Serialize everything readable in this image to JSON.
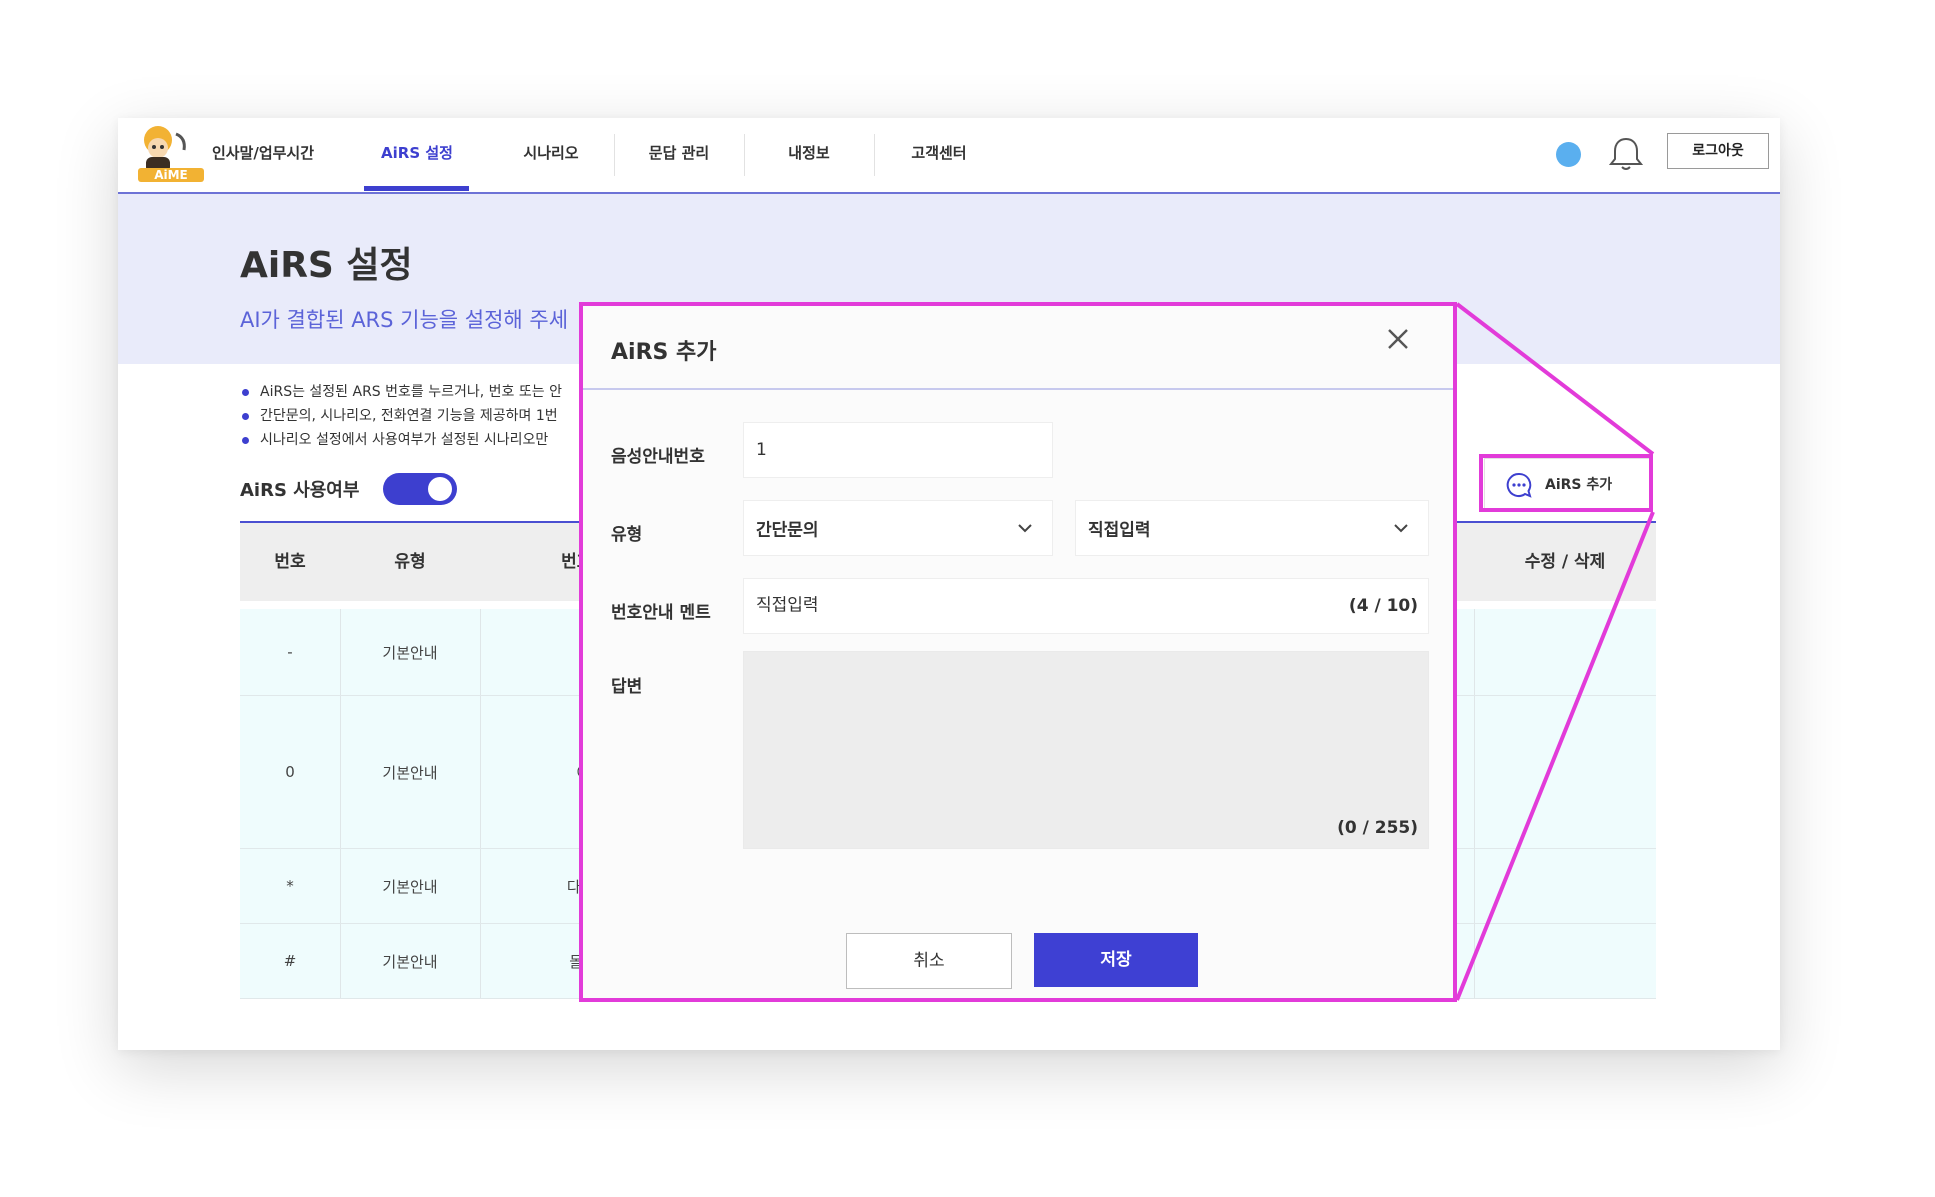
{
  "nav": {
    "items": [
      {
        "label": "인사말/업무시간"
      },
      {
        "label": "AiRS 설정"
      },
      {
        "label": "시나리오"
      },
      {
        "label": "문답 관리"
      },
      {
        "label": "내정보"
      },
      {
        "label": "고객센터"
      }
    ],
    "active_index": 1,
    "logout_label": "로그아웃",
    "logo_text": "AiME"
  },
  "hero": {
    "title": "AiRS 설정",
    "subtitle": "AI가 결합된 ARS 기능을 설정해 주세"
  },
  "notes": [
    "AiRS는 설정된 ARS 번호를 누르거나, 번호 또는 안",
    "간단문의, 시나리오, 전화연결 기능을 제공하며 1번",
    "시나리오 설정에서 사용여부가 설정된 시나리오만"
  ],
  "toggle": {
    "label": "AiRS 사용여부",
    "on": true
  },
  "add_button": {
    "label": "AiRS 추가"
  },
  "table": {
    "headers": [
      "번호",
      "유형",
      "번호안L",
      "수정 / 삭제"
    ],
    "rows": [
      {
        "num": "-",
        "type": "기본안내",
        "info": "-"
      },
      {
        "num": "0",
        "type": "기본안내",
        "info": "이용"
      },
      {
        "num": "*",
        "type": "기본안내",
        "info": "다시 듣"
      },
      {
        "num": "#",
        "type": "기본안내",
        "info": "돌아가"
      }
    ]
  },
  "modal": {
    "title": "AiRS 추가",
    "voice_number_label": "음성안내번호",
    "voice_number_value": "1",
    "type_label": "유형",
    "type_select_value": "간단문의",
    "type_sub_select_value": "직접입력",
    "ment_label": "번호안내 멘트",
    "ment_value": "직접입력",
    "ment_counter": "(4 / 10)",
    "answer_label": "답변",
    "answer_counter": "(0 / 255)",
    "cancel_label": "취소",
    "save_label": "저장"
  },
  "colors": {
    "accent": "#3d3fcf",
    "highlight": "#e23bd9",
    "hero_bg": "#e9ebfa",
    "row_bg": "#effcfd"
  }
}
